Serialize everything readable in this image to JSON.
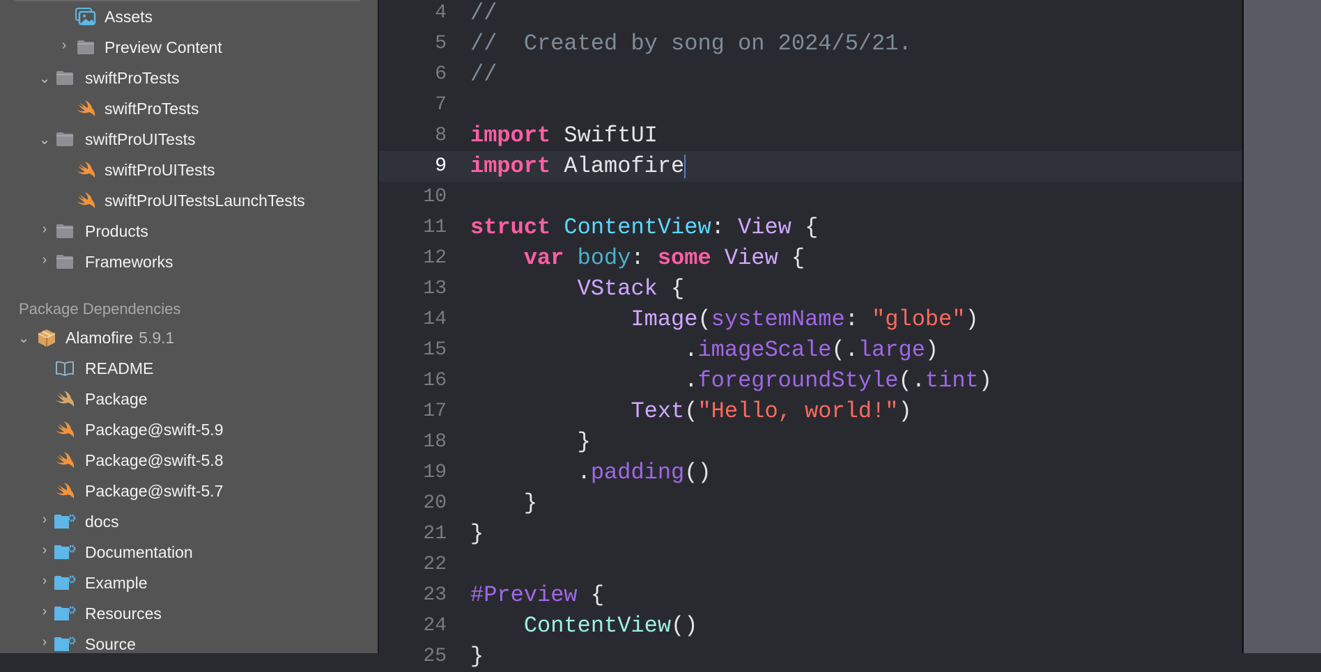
{
  "navigator": {
    "items": [
      {
        "label": "Assets",
        "icon": "asset-catalog-icon",
        "level": 2,
        "chevron": "none"
      },
      {
        "label": "Preview Content",
        "icon": "folder-icon",
        "level": 2,
        "chevron": "collapsed"
      },
      {
        "label": "swiftProTests",
        "icon": "folder-icon",
        "level": 1,
        "chevron": "expanded"
      },
      {
        "label": "swiftProTests",
        "icon": "swift-file-icon",
        "level": 2,
        "chevron": "none"
      },
      {
        "label": "swiftProUITests",
        "icon": "folder-icon",
        "level": 1,
        "chevron": "expanded"
      },
      {
        "label": "swiftProUITests",
        "icon": "swift-file-icon",
        "level": 2,
        "chevron": "none"
      },
      {
        "label": "swiftProUITestsLaunchTests",
        "icon": "swift-file-icon",
        "level": 2,
        "chevron": "none"
      },
      {
        "label": "Products",
        "icon": "folder-icon",
        "level": 1,
        "chevron": "collapsed"
      },
      {
        "label": "Frameworks",
        "icon": "folder-icon",
        "level": 1,
        "chevron": "collapsed"
      }
    ],
    "package_section": "Package Dependencies",
    "package": {
      "label": "Alamofire",
      "version": "5.9.1",
      "icon": "package-icon"
    },
    "package_items": [
      {
        "label": "README",
        "icon": "book-icon",
        "chevron": "none"
      },
      {
        "label": "Package",
        "icon": "swift-file-icon",
        "chevron": "none"
      },
      {
        "label": "Package@swift-5.9",
        "icon": "swift-file-icon",
        "chevron": "none"
      },
      {
        "label": "Package@swift-5.8",
        "icon": "swift-file-icon",
        "chevron": "none"
      },
      {
        "label": "Package@swift-5.7",
        "icon": "swift-file-icon",
        "chevron": "none"
      },
      {
        "label": "docs",
        "icon": "blue-folder-icon",
        "chevron": "collapsed"
      },
      {
        "label": "Documentation",
        "icon": "blue-folder-icon",
        "chevron": "collapsed"
      },
      {
        "label": "Example",
        "icon": "blue-folder-icon",
        "chevron": "collapsed"
      },
      {
        "label": "Resources",
        "icon": "blue-folder-icon",
        "chevron": "collapsed"
      },
      {
        "label": "Source",
        "icon": "blue-folder-icon",
        "chevron": "collapsed"
      }
    ]
  },
  "colors": {
    "keyword": "#fc5fa3",
    "comment": "#7f8c98",
    "type": "#d0a8ff",
    "decl": "#5dd8ff",
    "ident": "#4eb0cc",
    "method": "#a167e6",
    "string": "#fc6a5d",
    "plain": "#e6e6e8",
    "preview_call": "#9ef1dd",
    "swift_orange": "#f4933c",
    "folder_blue": "#5db7e8"
  },
  "editor": {
    "current_line": 9,
    "lines": [
      {
        "n": "4",
        "tokens": [
          [
            "comment",
            "//"
          ]
        ]
      },
      {
        "n": "5",
        "tokens": [
          [
            "comment",
            "//  Created by song on 2024/5/21."
          ]
        ]
      },
      {
        "n": "6",
        "tokens": [
          [
            "comment",
            "//"
          ]
        ]
      },
      {
        "n": "7",
        "tokens": []
      },
      {
        "n": "8",
        "tokens": [
          [
            "keyword",
            "import"
          ],
          [
            "plain",
            " SwiftUI"
          ]
        ]
      },
      {
        "n": "9",
        "tokens": [
          [
            "keyword",
            "import"
          ],
          [
            "plain",
            " Alamofire"
          ]
        ]
      },
      {
        "n": "10",
        "tokens": []
      },
      {
        "n": "11",
        "tokens": [
          [
            "keyword",
            "struct"
          ],
          [
            "plain",
            " "
          ],
          [
            "decl",
            "ContentView"
          ],
          [
            "plain",
            ": "
          ],
          [
            "type",
            "View"
          ],
          [
            "plain",
            " {"
          ]
        ]
      },
      {
        "n": "12",
        "tokens": [
          [
            "plain",
            "    "
          ],
          [
            "keyword",
            "var"
          ],
          [
            "plain",
            " "
          ],
          [
            "ident",
            "body"
          ],
          [
            "plain",
            ": "
          ],
          [
            "keyword",
            "some"
          ],
          [
            "plain",
            " "
          ],
          [
            "type",
            "View"
          ],
          [
            "plain",
            " {"
          ]
        ]
      },
      {
        "n": "13",
        "tokens": [
          [
            "plain",
            "        "
          ],
          [
            "type",
            "VStack"
          ],
          [
            "plain",
            " {"
          ]
        ]
      },
      {
        "n": "14",
        "tokens": [
          [
            "plain",
            "            "
          ],
          [
            "type",
            "Image"
          ],
          [
            "plain",
            "("
          ],
          [
            "method",
            "systemName"
          ],
          [
            "plain",
            ": "
          ],
          [
            "string",
            "\"globe\""
          ],
          [
            "plain",
            ")"
          ]
        ]
      },
      {
        "n": "15",
        "tokens": [
          [
            "plain",
            "                ."
          ],
          [
            "method",
            "imageScale"
          ],
          [
            "plain",
            "(."
          ],
          [
            "method",
            "large"
          ],
          [
            "plain",
            ")"
          ]
        ]
      },
      {
        "n": "16",
        "tokens": [
          [
            "plain",
            "                ."
          ],
          [
            "method",
            "foregroundStyle"
          ],
          [
            "plain",
            "(."
          ],
          [
            "method",
            "tint"
          ],
          [
            "plain",
            ")"
          ]
        ]
      },
      {
        "n": "17",
        "tokens": [
          [
            "plain",
            "            "
          ],
          [
            "type",
            "Text"
          ],
          [
            "plain",
            "("
          ],
          [
            "string",
            "\"Hello, world!\""
          ],
          [
            "plain",
            ")"
          ]
        ]
      },
      {
        "n": "18",
        "tokens": [
          [
            "plain",
            "        }"
          ]
        ]
      },
      {
        "n": "19",
        "tokens": [
          [
            "plain",
            "        ."
          ],
          [
            "method",
            "padding"
          ],
          [
            "plain",
            "()"
          ]
        ]
      },
      {
        "n": "20",
        "tokens": [
          [
            "plain",
            "    }"
          ]
        ]
      },
      {
        "n": "21",
        "tokens": [
          [
            "plain",
            "}"
          ]
        ]
      },
      {
        "n": "22",
        "tokens": []
      },
      {
        "n": "23",
        "tokens": [
          [
            "method",
            "#Preview"
          ],
          [
            "plain",
            " {"
          ]
        ]
      },
      {
        "n": "24",
        "tokens": [
          [
            "plain",
            "    "
          ],
          [
            "preview_call",
            "ContentView"
          ],
          [
            "plain",
            "()"
          ]
        ]
      },
      {
        "n": "25",
        "tokens": [
          [
            "plain",
            "}"
          ]
        ]
      }
    ]
  }
}
